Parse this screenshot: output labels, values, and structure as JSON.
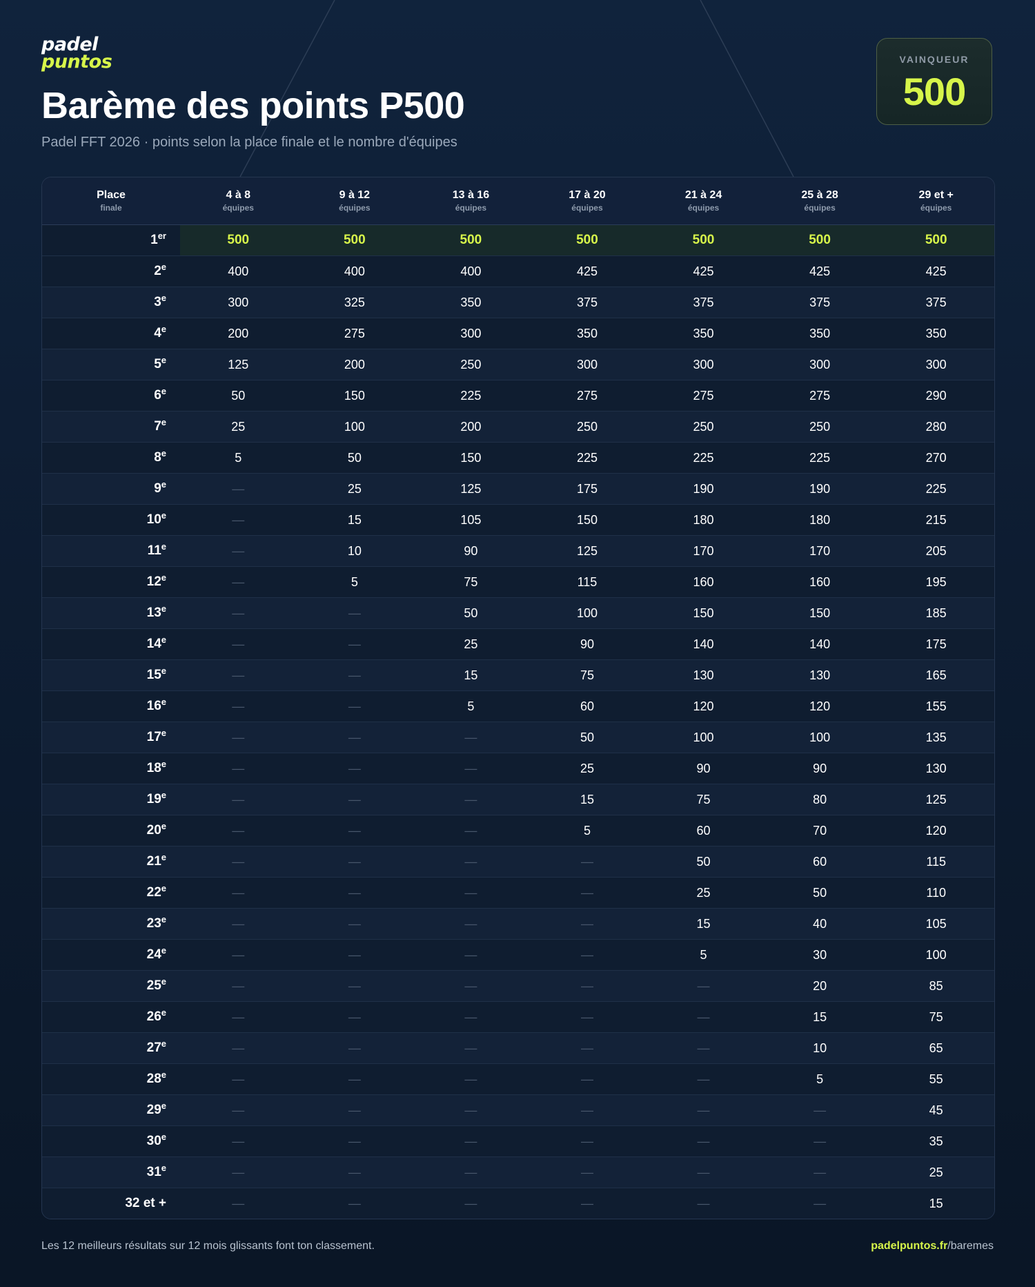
{
  "brand": {
    "line1": "padel",
    "line2": "puntos"
  },
  "header": {
    "title": "Barème des points P500",
    "subtitle": "Padel FFT 2026 · points selon la place finale et le nombre d'équipes"
  },
  "winner": {
    "label": "VAINQUEUR",
    "value": "500"
  },
  "table": {
    "place_header": {
      "line1": "Place",
      "line2": "finale"
    },
    "columns": [
      {
        "line1": "4 à 8",
        "line2": "équipes"
      },
      {
        "line1": "9 à 12",
        "line2": "équipes"
      },
      {
        "line1": "13 à 16",
        "line2": "équipes"
      },
      {
        "line1": "17 à 20",
        "line2": "équipes"
      },
      {
        "line1": "21 à 24",
        "line2": "équipes"
      },
      {
        "line1": "25 à 28",
        "line2": "équipes"
      },
      {
        "line1": "29 et +",
        "line2": "équipes"
      }
    ],
    "rows": [
      {
        "place": "1",
        "suffix": "er",
        "values": [
          "500",
          "500",
          "500",
          "500",
          "500",
          "500",
          "500"
        ]
      },
      {
        "place": "2",
        "suffix": "e",
        "values": [
          "400",
          "400",
          "400",
          "425",
          "425",
          "425",
          "425"
        ]
      },
      {
        "place": "3",
        "suffix": "e",
        "values": [
          "300",
          "325",
          "350",
          "375",
          "375",
          "375",
          "375"
        ]
      },
      {
        "place": "4",
        "suffix": "e",
        "values": [
          "200",
          "275",
          "300",
          "350",
          "350",
          "350",
          "350"
        ]
      },
      {
        "place": "5",
        "suffix": "e",
        "values": [
          "125",
          "200",
          "250",
          "300",
          "300",
          "300",
          "300"
        ]
      },
      {
        "place": "6",
        "suffix": "e",
        "values": [
          "50",
          "150",
          "225",
          "275",
          "275",
          "275",
          "290"
        ]
      },
      {
        "place": "7",
        "suffix": "e",
        "values": [
          "25",
          "100",
          "200",
          "250",
          "250",
          "250",
          "280"
        ]
      },
      {
        "place": "8",
        "suffix": "e",
        "values": [
          "5",
          "50",
          "150",
          "225",
          "225",
          "225",
          "270"
        ]
      },
      {
        "place": "9",
        "suffix": "e",
        "values": [
          "—",
          "25",
          "125",
          "175",
          "190",
          "190",
          "225"
        ]
      },
      {
        "place": "10",
        "suffix": "e",
        "values": [
          "—",
          "15",
          "105",
          "150",
          "180",
          "180",
          "215"
        ]
      },
      {
        "place": "11",
        "suffix": "e",
        "values": [
          "—",
          "10",
          "90",
          "125",
          "170",
          "170",
          "205"
        ]
      },
      {
        "place": "12",
        "suffix": "e",
        "values": [
          "—",
          "5",
          "75",
          "115",
          "160",
          "160",
          "195"
        ]
      },
      {
        "place": "13",
        "suffix": "e",
        "values": [
          "—",
          "—",
          "50",
          "100",
          "150",
          "150",
          "185"
        ]
      },
      {
        "place": "14",
        "suffix": "e",
        "values": [
          "—",
          "—",
          "25",
          "90",
          "140",
          "140",
          "175"
        ]
      },
      {
        "place": "15",
        "suffix": "e",
        "values": [
          "—",
          "—",
          "15",
          "75",
          "130",
          "130",
          "165"
        ]
      },
      {
        "place": "16",
        "suffix": "e",
        "values": [
          "—",
          "—",
          "5",
          "60",
          "120",
          "120",
          "155"
        ]
      },
      {
        "place": "17",
        "suffix": "e",
        "values": [
          "—",
          "—",
          "—",
          "50",
          "100",
          "100",
          "135"
        ]
      },
      {
        "place": "18",
        "suffix": "e",
        "values": [
          "—",
          "—",
          "—",
          "25",
          "90",
          "90",
          "130"
        ]
      },
      {
        "place": "19",
        "suffix": "e",
        "values": [
          "—",
          "—",
          "—",
          "15",
          "75",
          "80",
          "125"
        ]
      },
      {
        "place": "20",
        "suffix": "e",
        "values": [
          "—",
          "—",
          "—",
          "5",
          "60",
          "70",
          "120"
        ]
      },
      {
        "place": "21",
        "suffix": "e",
        "values": [
          "—",
          "—",
          "—",
          "—",
          "50",
          "60",
          "115"
        ]
      },
      {
        "place": "22",
        "suffix": "e",
        "values": [
          "—",
          "—",
          "—",
          "—",
          "25",
          "50",
          "110"
        ]
      },
      {
        "place": "23",
        "suffix": "e",
        "values": [
          "—",
          "—",
          "—",
          "—",
          "15",
          "40",
          "105"
        ]
      },
      {
        "place": "24",
        "suffix": "e",
        "values": [
          "—",
          "—",
          "—",
          "—",
          "5",
          "30",
          "100"
        ]
      },
      {
        "place": "25",
        "suffix": "e",
        "values": [
          "—",
          "—",
          "—",
          "—",
          "—",
          "20",
          "85"
        ]
      },
      {
        "place": "26",
        "suffix": "e",
        "values": [
          "—",
          "—",
          "—",
          "—",
          "—",
          "15",
          "75"
        ]
      },
      {
        "place": "27",
        "suffix": "e",
        "values": [
          "—",
          "—",
          "—",
          "—",
          "—",
          "10",
          "65"
        ]
      },
      {
        "place": "28",
        "suffix": "e",
        "values": [
          "—",
          "—",
          "—",
          "—",
          "—",
          "5",
          "55"
        ]
      },
      {
        "place": "29",
        "suffix": "e",
        "values": [
          "—",
          "—",
          "—",
          "—",
          "—",
          "—",
          "45"
        ]
      },
      {
        "place": "30",
        "suffix": "e",
        "values": [
          "—",
          "—",
          "—",
          "—",
          "—",
          "—",
          "35"
        ]
      },
      {
        "place": "31",
        "suffix": "e",
        "values": [
          "—",
          "—",
          "—",
          "—",
          "—",
          "—",
          "25"
        ]
      },
      {
        "place": "32 et +",
        "suffix": "",
        "values": [
          "—",
          "—",
          "—",
          "—",
          "—",
          "—",
          "15"
        ]
      }
    ]
  },
  "footer": {
    "note": "Les 12 meilleurs résultats sur 12 mois glissants font ton classement.",
    "link_domain": "padelpuntos.fr",
    "link_path": "/baremes"
  },
  "colors": {
    "accent": "#d7f54a",
    "background": "#0d1c31",
    "table_header": "#12213a"
  }
}
